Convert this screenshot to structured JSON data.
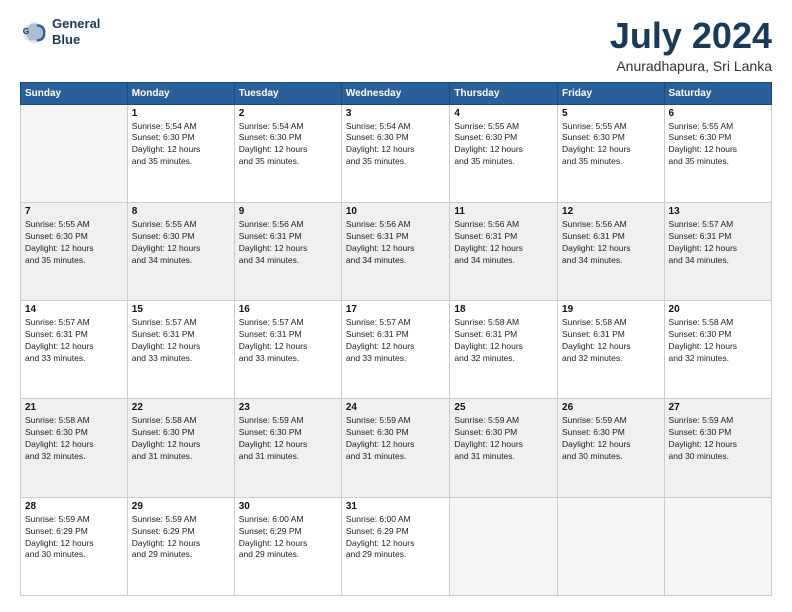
{
  "logo": {
    "line1": "General",
    "line2": "Blue"
  },
  "title": "July 2024",
  "subtitle": "Anuradhapura, Sri Lanka",
  "headers": [
    "Sunday",
    "Monday",
    "Tuesday",
    "Wednesday",
    "Thursday",
    "Friday",
    "Saturday"
  ],
  "weeks": [
    [
      {
        "day": "",
        "info": ""
      },
      {
        "day": "1",
        "info": "Sunrise: 5:54 AM\nSunset: 6:30 PM\nDaylight: 12 hours\nand 35 minutes."
      },
      {
        "day": "2",
        "info": "Sunrise: 5:54 AM\nSunset: 6:30 PM\nDaylight: 12 hours\nand 35 minutes."
      },
      {
        "day": "3",
        "info": "Sunrise: 5:54 AM\nSunset: 6:30 PM\nDaylight: 12 hours\nand 35 minutes."
      },
      {
        "day": "4",
        "info": "Sunrise: 5:55 AM\nSunset: 6:30 PM\nDaylight: 12 hours\nand 35 minutes."
      },
      {
        "day": "5",
        "info": "Sunrise: 5:55 AM\nSunset: 6:30 PM\nDaylight: 12 hours\nand 35 minutes."
      },
      {
        "day": "6",
        "info": "Sunrise: 5:55 AM\nSunset: 6:30 PM\nDaylight: 12 hours\nand 35 minutes."
      }
    ],
    [
      {
        "day": "7",
        "info": "Sunrise: 5:55 AM\nSunset: 6:30 PM\nDaylight: 12 hours\nand 35 minutes."
      },
      {
        "day": "8",
        "info": "Sunrise: 5:55 AM\nSunset: 6:30 PM\nDaylight: 12 hours\nand 34 minutes."
      },
      {
        "day": "9",
        "info": "Sunrise: 5:56 AM\nSunset: 6:31 PM\nDaylight: 12 hours\nand 34 minutes."
      },
      {
        "day": "10",
        "info": "Sunrise: 5:56 AM\nSunset: 6:31 PM\nDaylight: 12 hours\nand 34 minutes."
      },
      {
        "day": "11",
        "info": "Sunrise: 5:56 AM\nSunset: 6:31 PM\nDaylight: 12 hours\nand 34 minutes."
      },
      {
        "day": "12",
        "info": "Sunrise: 5:56 AM\nSunset: 6:31 PM\nDaylight: 12 hours\nand 34 minutes."
      },
      {
        "day": "13",
        "info": "Sunrise: 5:57 AM\nSunset: 6:31 PM\nDaylight: 12 hours\nand 34 minutes."
      }
    ],
    [
      {
        "day": "14",
        "info": "Sunrise: 5:57 AM\nSunset: 6:31 PM\nDaylight: 12 hours\nand 33 minutes."
      },
      {
        "day": "15",
        "info": "Sunrise: 5:57 AM\nSunset: 6:31 PM\nDaylight: 12 hours\nand 33 minutes."
      },
      {
        "day": "16",
        "info": "Sunrise: 5:57 AM\nSunset: 6:31 PM\nDaylight: 12 hours\nand 33 minutes."
      },
      {
        "day": "17",
        "info": "Sunrise: 5:57 AM\nSunset: 6:31 PM\nDaylight: 12 hours\nand 33 minutes."
      },
      {
        "day": "18",
        "info": "Sunrise: 5:58 AM\nSunset: 6:31 PM\nDaylight: 12 hours\nand 32 minutes."
      },
      {
        "day": "19",
        "info": "Sunrise: 5:58 AM\nSunset: 6:31 PM\nDaylight: 12 hours\nand 32 minutes."
      },
      {
        "day": "20",
        "info": "Sunrise: 5:58 AM\nSunset: 6:30 PM\nDaylight: 12 hours\nand 32 minutes."
      }
    ],
    [
      {
        "day": "21",
        "info": "Sunrise: 5:58 AM\nSunset: 6:30 PM\nDaylight: 12 hours\nand 32 minutes."
      },
      {
        "day": "22",
        "info": "Sunrise: 5:58 AM\nSunset: 6:30 PM\nDaylight: 12 hours\nand 31 minutes."
      },
      {
        "day": "23",
        "info": "Sunrise: 5:59 AM\nSunset: 6:30 PM\nDaylight: 12 hours\nand 31 minutes."
      },
      {
        "day": "24",
        "info": "Sunrise: 5:59 AM\nSunset: 6:30 PM\nDaylight: 12 hours\nand 31 minutes."
      },
      {
        "day": "25",
        "info": "Sunrise: 5:59 AM\nSunset: 6:30 PM\nDaylight: 12 hours\nand 31 minutes."
      },
      {
        "day": "26",
        "info": "Sunrise: 5:59 AM\nSunset: 6:30 PM\nDaylight: 12 hours\nand 30 minutes."
      },
      {
        "day": "27",
        "info": "Sunrise: 5:59 AM\nSunset: 6:30 PM\nDaylight: 12 hours\nand 30 minutes."
      }
    ],
    [
      {
        "day": "28",
        "info": "Sunrise: 5:59 AM\nSunset: 6:29 PM\nDaylight: 12 hours\nand 30 minutes."
      },
      {
        "day": "29",
        "info": "Sunrise: 5:59 AM\nSunset: 6:29 PM\nDaylight: 12 hours\nand 29 minutes."
      },
      {
        "day": "30",
        "info": "Sunrise: 6:00 AM\nSunset: 6:29 PM\nDaylight: 12 hours\nand 29 minutes."
      },
      {
        "day": "31",
        "info": "Sunrise: 6:00 AM\nSunset: 6:29 PM\nDaylight: 12 hours\nand 29 minutes."
      },
      {
        "day": "",
        "info": ""
      },
      {
        "day": "",
        "info": ""
      },
      {
        "day": "",
        "info": ""
      }
    ]
  ]
}
